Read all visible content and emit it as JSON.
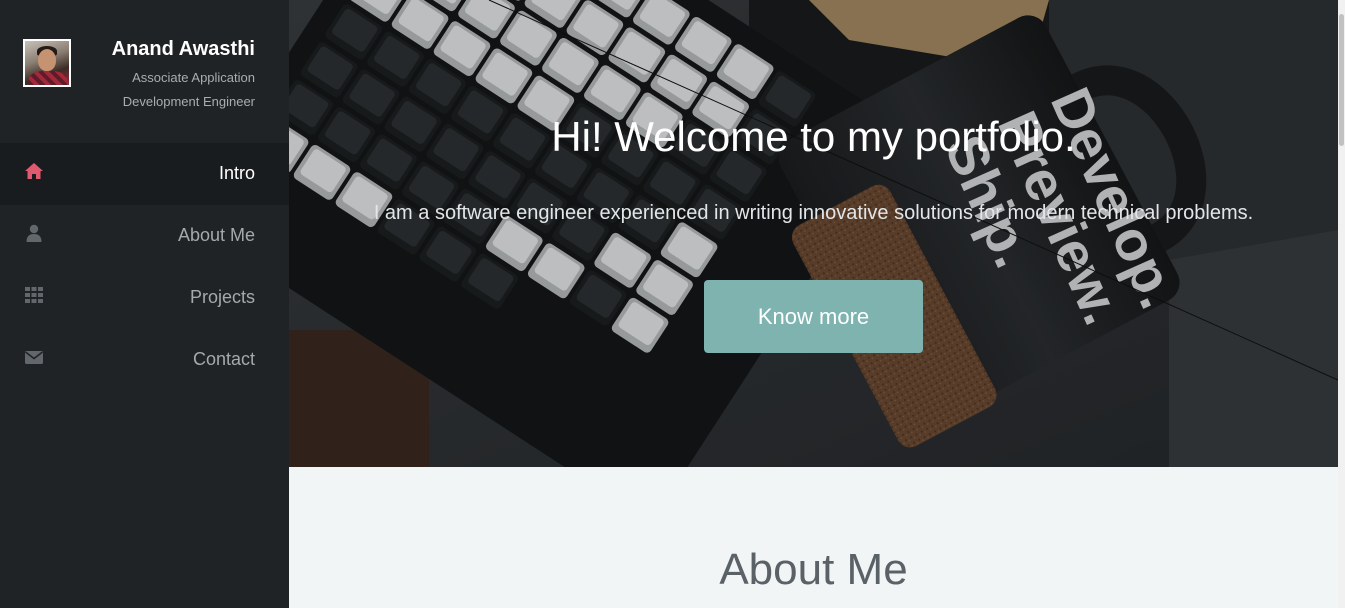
{
  "sidebar": {
    "profile": {
      "name": "Anand Awasthi",
      "role": "Associate Application Development Engineer"
    },
    "nav": [
      {
        "label": "Intro",
        "icon": "home-icon",
        "active": true
      },
      {
        "label": "About Me",
        "icon": "user-icon",
        "active": false
      },
      {
        "label": "Projects",
        "icon": "grid-icon",
        "active": false
      },
      {
        "label": "Contact",
        "icon": "envelope-icon",
        "active": false
      }
    ]
  },
  "hero": {
    "title": "Hi! Welcome to my portfolio.",
    "subtitle": "I am a software engineer experienced in writing innovative solutions for modern technical problems.",
    "button_label": "Know more",
    "mug_text": "Develop. Preview. Ship."
  },
  "about": {
    "title": "About Me"
  },
  "colors": {
    "sidebar_bg": "#1f2326",
    "active_item_bg": "#191c1e",
    "accent_icon": "#e05a6f",
    "button_bg": "#7fb3b0"
  }
}
